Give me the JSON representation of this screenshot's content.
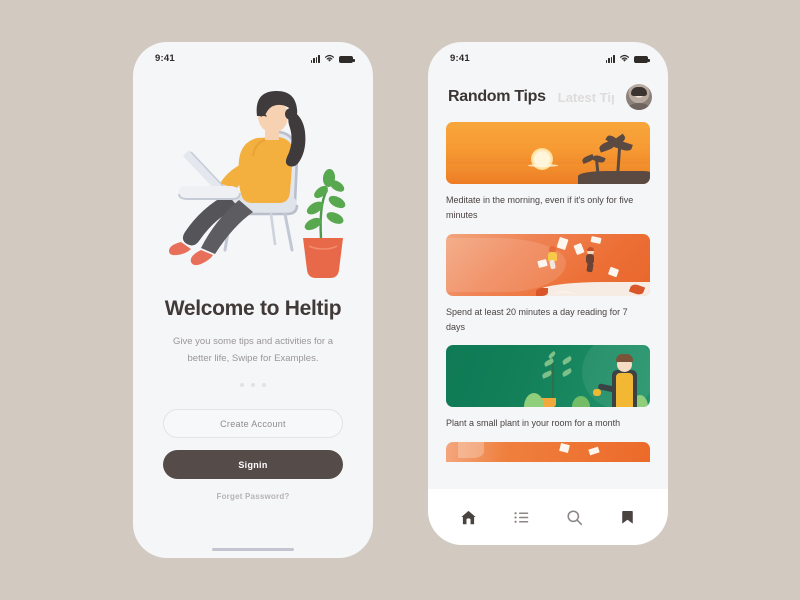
{
  "background_color": "#d2c9c1",
  "screens": [
    {
      "id": "onboarding",
      "status_bar": {
        "time": "9:41",
        "icons": [
          "signal-icon",
          "wifi-icon",
          "battery-icon"
        ]
      },
      "illustration": "woman-sitting-on-chair-with-laptop-and-plant",
      "title": "Welcome to Heltip",
      "subtitle": "Give you some tips and activities for a better life, Swipe for Examples.",
      "pagination_dots": 3,
      "buttons": {
        "create_account": "Create Account",
        "signin": "Signin",
        "forget_password": "Forget Password?"
      },
      "colors": {
        "primary_button": "#554c49",
        "title": "#413a38",
        "subtitle": "#9a9698"
      }
    },
    {
      "id": "tips-feed",
      "status_bar": {
        "time": "9:41",
        "icons": [
          "signal-icon",
          "wifi-icon",
          "battery-icon"
        ]
      },
      "header": {
        "active_tab": "Random Tips",
        "inactive_tab": "Latest Tips",
        "avatar": "user-avatar"
      },
      "cards": [
        {
          "image": "sunset-palm-trees",
          "text": "Meditate in the morning, even if it's only for five minutes"
        },
        {
          "image": "people-reading-books",
          "text": "Spend at least 20 minutes a day reading for 7 days"
        },
        {
          "image": "man-gardening-plant",
          "text": "Plant a small plant in your room for a month"
        },
        {
          "image": "orange-partial-card",
          "text": ""
        }
      ],
      "tabbar": [
        {
          "icon": "home-icon",
          "active": true
        },
        {
          "icon": "list-icon",
          "active": false
        },
        {
          "icon": "search-icon",
          "active": false
        },
        {
          "icon": "bookmark-icon",
          "active": false
        }
      ]
    }
  ]
}
